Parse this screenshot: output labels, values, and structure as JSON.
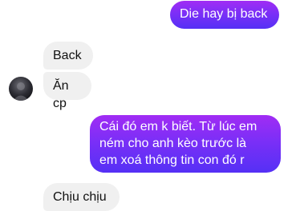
{
  "conversation": {
    "messages": [
      {
        "id": "m1",
        "direction": "outgoing",
        "text": "Die hay bị back"
      },
      {
        "id": "m2",
        "direction": "incoming",
        "text": "Back"
      },
      {
        "id": "m3",
        "direction": "incoming",
        "text": "Ăn cp"
      },
      {
        "id": "m4",
        "direction": "outgoing",
        "text": "Cái đó em k biết. Từ lúc em\nném cho anh kèo trước là\nem xoá thông tin con đó r"
      },
      {
        "id": "m5",
        "direction": "incoming",
        "text": "Chịu chịu"
      }
    ]
  },
  "colors": {
    "outgoing_gradient": [
      "#a12cf4",
      "#5530f5"
    ],
    "incoming_bubble": "#f0f0f0",
    "background": "#ffffff"
  },
  "icons": {
    "contact_avatar": "avatar-icon"
  }
}
